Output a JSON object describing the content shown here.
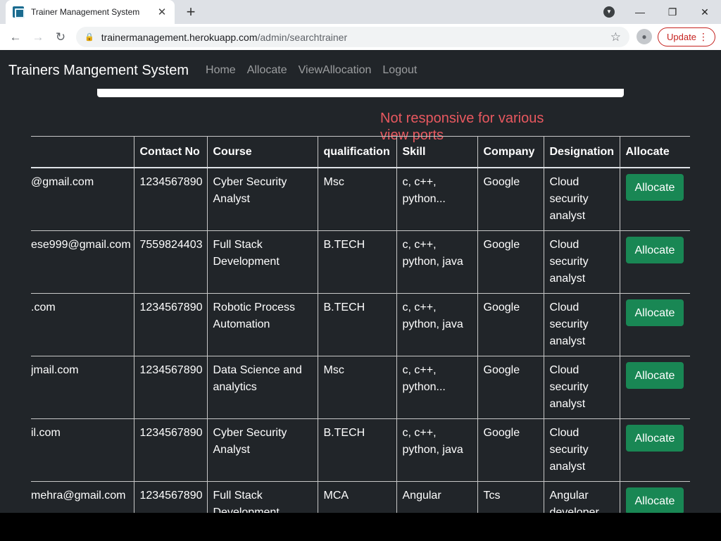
{
  "browser": {
    "tab_title": "Trainer Management System",
    "tab_close": "✕",
    "new_tab": "+",
    "url_host": "trainermanagement.herokuapp.com",
    "url_path": "/admin/searchtrainer",
    "update_label": "Update"
  },
  "navbar": {
    "brand": "Trainers Mangement System",
    "links": [
      "Home",
      "Allocate",
      "ViewAllocation",
      "Logout"
    ]
  },
  "annotation": "Not responsive for various view ports",
  "table": {
    "headers": [
      "",
      "Contact No",
      "Course",
      "qualification",
      "Skill",
      "Company",
      "Designation",
      "Allocate"
    ],
    "rows": [
      {
        "email": "@gmail.com",
        "contact": "1234567890",
        "course": "Cyber Security Analyst",
        "qualification": "Msc",
        "skill": "c, c++, python...",
        "company": "Google",
        "designation": "Cloud security analyst",
        "action": "Allocate"
      },
      {
        "email": "ese999@gmail.com",
        "contact": "7559824403",
        "course": "Full Stack Development",
        "qualification": "B.TECH",
        "skill": "c, c++, python, java",
        "company": "Google",
        "designation": "Cloud security analyst",
        "action": "Allocate"
      },
      {
        "email": ".com",
        "contact": "1234567890",
        "course": "Robotic Process Automation",
        "qualification": "B.TECH",
        "skill": "c, c++, python, java",
        "company": "Google",
        "designation": "Cloud security analyst",
        "action": "Allocate"
      },
      {
        "email": "jmail.com",
        "contact": "1234567890",
        "course": "Data Science and analytics",
        "qualification": "Msc",
        "skill": "c, c++, python...",
        "company": "Google",
        "designation": "Cloud security analyst",
        "action": "Allocate"
      },
      {
        "email": "il.com",
        "contact": "1234567890",
        "course": "Cyber Security Analyst",
        "qualification": "B.TECH",
        "skill": "c, c++, python, java",
        "company": "Google",
        "designation": "Cloud security analyst",
        "action": "Allocate"
      },
      {
        "email": "mehra@gmail.com",
        "contact": "1234567890",
        "course": "Full Stack Development",
        "qualification": "MCA",
        "skill": "Angular",
        "company": "Tcs",
        "designation": "Angular developer",
        "action": "Allocate"
      }
    ]
  }
}
